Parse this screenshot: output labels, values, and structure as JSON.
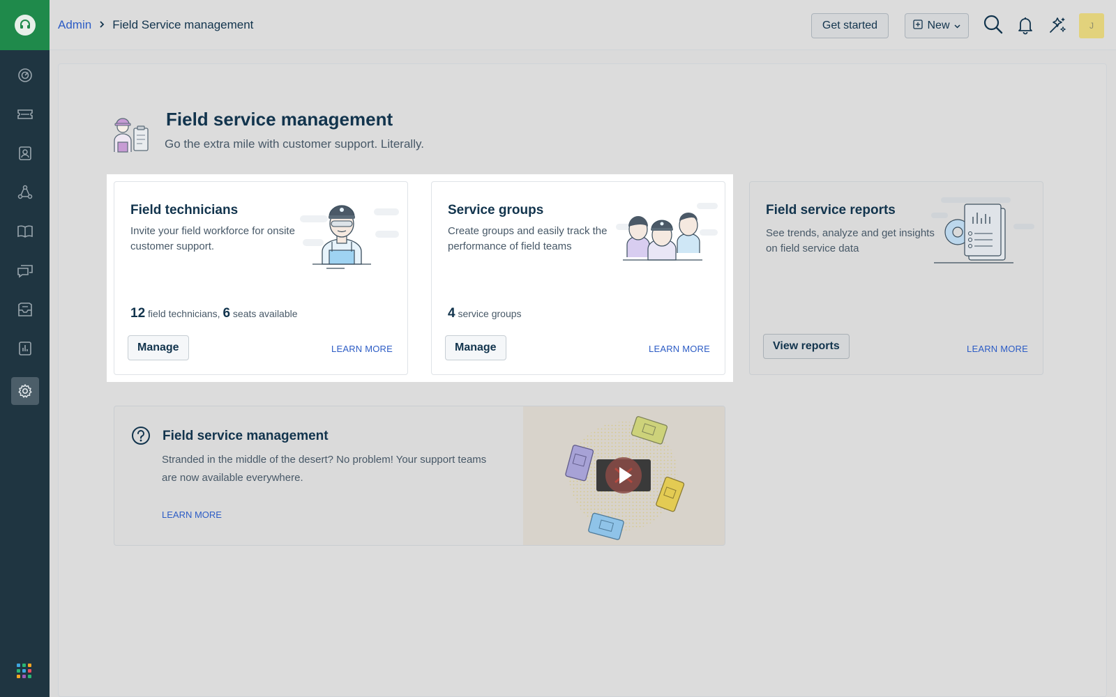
{
  "header": {
    "breadcrumb": {
      "root": "Admin",
      "current": "Field Service management"
    },
    "get_started_label": "Get started",
    "new_label": "New",
    "avatar_initial": "J"
  },
  "page": {
    "title": "Field service management",
    "subtitle": "Go the extra mile with customer support. Literally."
  },
  "cards": [
    {
      "title": "Field technicians",
      "description": "Invite your field workforce for onsite customer support.",
      "stat_count": "12",
      "stat_count_label": "field technicians,",
      "stat_secondary": "6",
      "stat_secondary_label": "seats available",
      "button": "Manage",
      "learn_more": "LEARN MORE"
    },
    {
      "title": "Service groups",
      "description": "Create groups and easily track the performance of field teams",
      "stat_count": "4",
      "stat_count_label": "service groups",
      "button": "Manage",
      "learn_more": "LEARN MORE"
    },
    {
      "title": "Field service reports",
      "description": "See trends, analyze and get insights on field service data",
      "button": "View reports",
      "learn_more": "LEARN MORE"
    }
  ],
  "info": {
    "title": "Field service management",
    "description": "Stranded in the middle of the desert? No problem! Your support teams are now available everywhere.",
    "learn_more": "LEARN MORE"
  },
  "sidebar": {
    "items": [
      "dashboard-icon",
      "tickets-icon",
      "contacts-icon",
      "social-icon",
      "solutions-icon",
      "forums-icon",
      "inbox-icon",
      "reports-icon",
      "admin-gear-icon"
    ],
    "active": "admin-gear-icon"
  },
  "colors": {
    "sidebar_bg": "#1f3541",
    "logo_bg": "#1f8a4b",
    "link": "#2c5cc5",
    "text_primary": "#12344d",
    "text_secondary": "#475867"
  }
}
